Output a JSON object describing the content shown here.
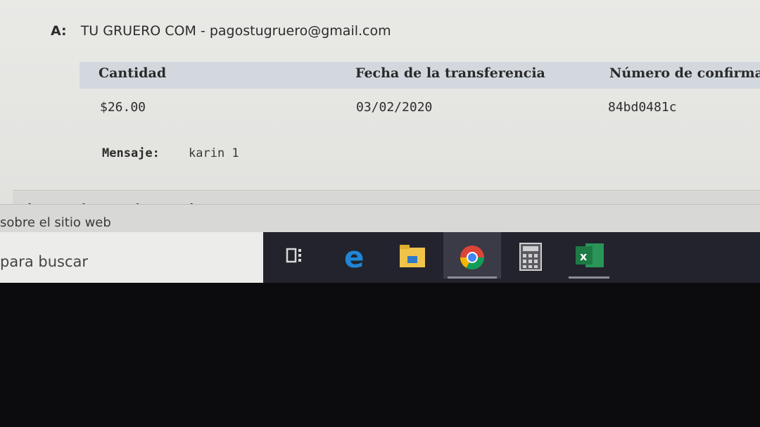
{
  "email": {
    "to_label": "A:",
    "to_value": "TU GRUERO COM - pagostugruero@gmail.com"
  },
  "table": {
    "headers": [
      "Cantidad",
      "Fecha de la transferencia",
      "Número de confirmac"
    ],
    "row": [
      "$26.00",
      "03/02/2020",
      "84bd0481c"
    ]
  },
  "message": {
    "label": "Mensaje:",
    "value": "karin 1"
  },
  "browser": {
    "footer_dots": "• • • •",
    "status_text": "sobre el sitio web"
  },
  "taskbar": {
    "search_placeholder": "para buscar",
    "icons": [
      "task-view-icon",
      "edge-icon",
      "file-explorer-icon",
      "chrome-icon",
      "calculator-icon",
      "excel-icon"
    ],
    "colors": {
      "background": "#22232c",
      "edge": "#1f86d6",
      "explorer": "#f0c34a",
      "chrome_red": "#db4437",
      "chrome_green": "#0f9d58",
      "chrome_yellow": "#f4b400",
      "excel": "#1d7a45"
    }
  }
}
